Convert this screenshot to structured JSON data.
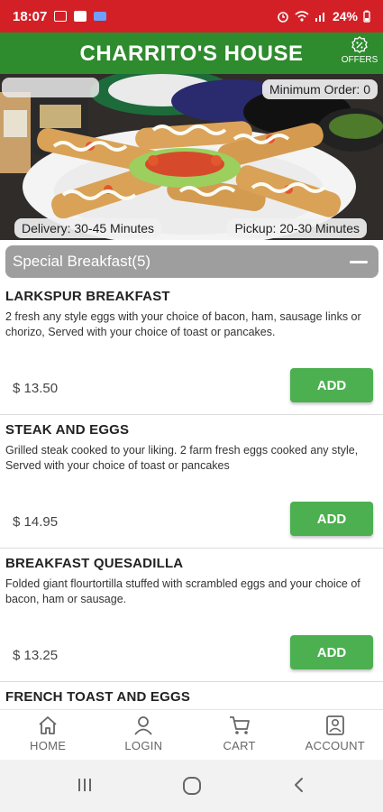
{
  "status_bar": {
    "time": "18:07",
    "battery": "24%"
  },
  "header": {
    "title": "CHARRITO'S HOUSE",
    "offers_label": "OFFERS"
  },
  "hero": {
    "min_order": "Minimum Order:  0",
    "delivery": "Delivery:  30-45 Minutes",
    "pickup": "Pickup:  20-30 Minutes"
  },
  "category": {
    "title": "Special Breakfast(5)"
  },
  "items": [
    {
      "name": "LARKSPUR BREAKFAST",
      "description": "2 fresh any style eggs with your choice of bacon, ham, sausage links or chorizo, Served with your choice of toast or pancakes.",
      "price": "$ 13.50",
      "add_label": "ADD"
    },
    {
      "name": "STEAK AND EGGS",
      "description": "Grilled steak cooked to your liking. 2 farm fresh eggs cooked any style, Served with your choice of toast or pancakes",
      "price": "$ 14.95",
      "add_label": "ADD"
    },
    {
      "name": "BREAKFAST QUESADILLA",
      "description": "Folded giant flourtortilla stuffed with scrambled eggs and your choice of bacon, ham or sausage.",
      "price": "$ 13.25",
      "add_label": "ADD"
    },
    {
      "name": "FRENCH TOAST AND EGGS",
      "description": "",
      "price": "",
      "add_label": ""
    }
  ],
  "nav": {
    "home": "HOME",
    "login": "LOGIN",
    "cart": "CART",
    "account": "ACCOUNT"
  },
  "colors": {
    "status_bar": "#d32027",
    "header": "#2e8b2e",
    "add_button": "#4caf50",
    "category_bar": "#9e9e9e"
  },
  "icons": [
    "home-icon",
    "user-icon",
    "cart-icon",
    "account-icon",
    "offers-icon",
    "recents-icon",
    "home-circle-icon",
    "back-icon"
  ]
}
